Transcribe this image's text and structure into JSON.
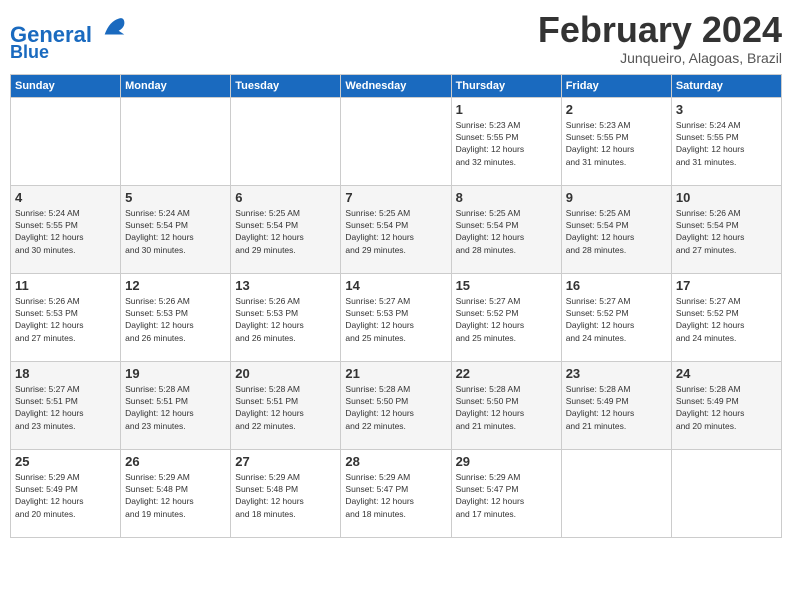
{
  "header": {
    "logo_line1": "General",
    "logo_line2": "Blue",
    "month": "February 2024",
    "location": "Junqueiro, Alagoas, Brazil"
  },
  "days_of_week": [
    "Sunday",
    "Monday",
    "Tuesday",
    "Wednesday",
    "Thursday",
    "Friday",
    "Saturday"
  ],
  "weeks": [
    [
      {
        "day": "",
        "info": ""
      },
      {
        "day": "",
        "info": ""
      },
      {
        "day": "",
        "info": ""
      },
      {
        "day": "",
        "info": ""
      },
      {
        "day": "1",
        "info": "Sunrise: 5:23 AM\nSunset: 5:55 PM\nDaylight: 12 hours\nand 32 minutes."
      },
      {
        "day": "2",
        "info": "Sunrise: 5:23 AM\nSunset: 5:55 PM\nDaylight: 12 hours\nand 31 minutes."
      },
      {
        "day": "3",
        "info": "Sunrise: 5:24 AM\nSunset: 5:55 PM\nDaylight: 12 hours\nand 31 minutes."
      }
    ],
    [
      {
        "day": "4",
        "info": "Sunrise: 5:24 AM\nSunset: 5:55 PM\nDaylight: 12 hours\nand 30 minutes."
      },
      {
        "day": "5",
        "info": "Sunrise: 5:24 AM\nSunset: 5:54 PM\nDaylight: 12 hours\nand 30 minutes."
      },
      {
        "day": "6",
        "info": "Sunrise: 5:25 AM\nSunset: 5:54 PM\nDaylight: 12 hours\nand 29 minutes."
      },
      {
        "day": "7",
        "info": "Sunrise: 5:25 AM\nSunset: 5:54 PM\nDaylight: 12 hours\nand 29 minutes."
      },
      {
        "day": "8",
        "info": "Sunrise: 5:25 AM\nSunset: 5:54 PM\nDaylight: 12 hours\nand 28 minutes."
      },
      {
        "day": "9",
        "info": "Sunrise: 5:25 AM\nSunset: 5:54 PM\nDaylight: 12 hours\nand 28 minutes."
      },
      {
        "day": "10",
        "info": "Sunrise: 5:26 AM\nSunset: 5:54 PM\nDaylight: 12 hours\nand 27 minutes."
      }
    ],
    [
      {
        "day": "11",
        "info": "Sunrise: 5:26 AM\nSunset: 5:53 PM\nDaylight: 12 hours\nand 27 minutes."
      },
      {
        "day": "12",
        "info": "Sunrise: 5:26 AM\nSunset: 5:53 PM\nDaylight: 12 hours\nand 26 minutes."
      },
      {
        "day": "13",
        "info": "Sunrise: 5:26 AM\nSunset: 5:53 PM\nDaylight: 12 hours\nand 26 minutes."
      },
      {
        "day": "14",
        "info": "Sunrise: 5:27 AM\nSunset: 5:53 PM\nDaylight: 12 hours\nand 25 minutes."
      },
      {
        "day": "15",
        "info": "Sunrise: 5:27 AM\nSunset: 5:52 PM\nDaylight: 12 hours\nand 25 minutes."
      },
      {
        "day": "16",
        "info": "Sunrise: 5:27 AM\nSunset: 5:52 PM\nDaylight: 12 hours\nand 24 minutes."
      },
      {
        "day": "17",
        "info": "Sunrise: 5:27 AM\nSunset: 5:52 PM\nDaylight: 12 hours\nand 24 minutes."
      }
    ],
    [
      {
        "day": "18",
        "info": "Sunrise: 5:27 AM\nSunset: 5:51 PM\nDaylight: 12 hours\nand 23 minutes."
      },
      {
        "day": "19",
        "info": "Sunrise: 5:28 AM\nSunset: 5:51 PM\nDaylight: 12 hours\nand 23 minutes."
      },
      {
        "day": "20",
        "info": "Sunrise: 5:28 AM\nSunset: 5:51 PM\nDaylight: 12 hours\nand 22 minutes."
      },
      {
        "day": "21",
        "info": "Sunrise: 5:28 AM\nSunset: 5:50 PM\nDaylight: 12 hours\nand 22 minutes."
      },
      {
        "day": "22",
        "info": "Sunrise: 5:28 AM\nSunset: 5:50 PM\nDaylight: 12 hours\nand 21 minutes."
      },
      {
        "day": "23",
        "info": "Sunrise: 5:28 AM\nSunset: 5:49 PM\nDaylight: 12 hours\nand 21 minutes."
      },
      {
        "day": "24",
        "info": "Sunrise: 5:28 AM\nSunset: 5:49 PM\nDaylight: 12 hours\nand 20 minutes."
      }
    ],
    [
      {
        "day": "25",
        "info": "Sunrise: 5:29 AM\nSunset: 5:49 PM\nDaylight: 12 hours\nand 20 minutes."
      },
      {
        "day": "26",
        "info": "Sunrise: 5:29 AM\nSunset: 5:48 PM\nDaylight: 12 hours\nand 19 minutes."
      },
      {
        "day": "27",
        "info": "Sunrise: 5:29 AM\nSunset: 5:48 PM\nDaylight: 12 hours\nand 18 minutes."
      },
      {
        "day": "28",
        "info": "Sunrise: 5:29 AM\nSunset: 5:47 PM\nDaylight: 12 hours\nand 18 minutes."
      },
      {
        "day": "29",
        "info": "Sunrise: 5:29 AM\nSunset: 5:47 PM\nDaylight: 12 hours\nand 17 minutes."
      },
      {
        "day": "",
        "info": ""
      },
      {
        "day": "",
        "info": ""
      }
    ]
  ]
}
